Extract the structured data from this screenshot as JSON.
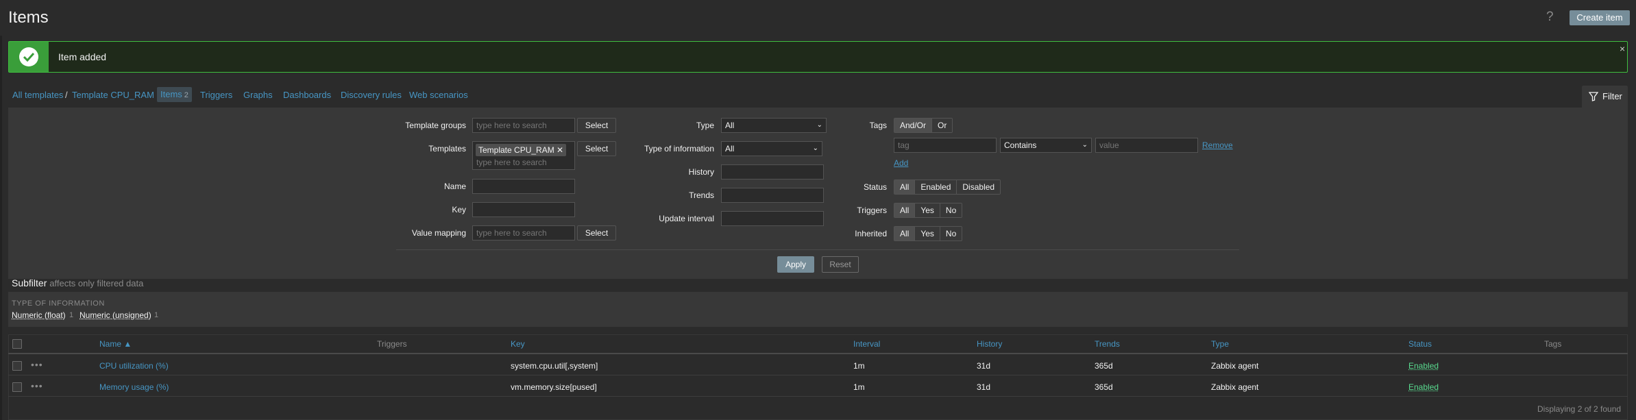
{
  "header": {
    "title": "Items",
    "help_icon": "?",
    "create_button": "Create item"
  },
  "message": {
    "text": "Item added",
    "close": "×",
    "color": "#3fbf3f"
  },
  "nav": {
    "all_templates": "All templates",
    "separator": "/",
    "template": "Template CPU_RAM",
    "items_label": "Items",
    "items_count": "2",
    "triggers": "Triggers",
    "graphs": "Graphs",
    "dashboards": "Dashboards",
    "discovery": "Discovery rules",
    "web": "Web scenarios",
    "filter": "Filter"
  },
  "filter": {
    "template_groups_label": "Template groups",
    "template_groups_placeholder": "type here to search",
    "select": "Select",
    "templates_label": "Templates",
    "templates_chip": "Template CPU_RAM",
    "templates_placeholder": "type here to search",
    "name_label": "Name",
    "key_label": "Key",
    "value_mapping_label": "Value mapping",
    "value_mapping_placeholder": "type here to search",
    "type_label": "Type",
    "type_value": "All",
    "type_info_label": "Type of information",
    "type_info_value": "All",
    "history_label": "History",
    "trends_label": "Trends",
    "update_interval_label": "Update interval",
    "tags_label": "Tags",
    "tags_andor": "And/Or",
    "tags_or": "Or",
    "tag_placeholder": "tag",
    "tag_operator": "Contains",
    "value_placeholder": "value",
    "remove": "Remove",
    "add": "Add",
    "status_label": "Status",
    "status_options": [
      "All",
      "Enabled",
      "Disabled"
    ],
    "triggers_label": "Triggers",
    "triggers_options": [
      "All",
      "Yes",
      "No"
    ],
    "inherited_label": "Inherited",
    "inherited_options": [
      "All",
      "Yes",
      "No"
    ],
    "apply": "Apply",
    "reset": "Reset"
  },
  "subfilter": {
    "title": "Subfilter",
    "hint": "affects only filtered data",
    "category": "TYPE OF INFORMATION",
    "items": [
      {
        "label": "Numeric (float)",
        "count": "1"
      },
      {
        "label": "Numeric (unsigned)",
        "count": "1"
      }
    ]
  },
  "table": {
    "columns": {
      "name": "Name ▲",
      "triggers": "Triggers",
      "key": "Key",
      "interval": "Interval",
      "history": "History",
      "trends": "Trends",
      "type": "Type",
      "status": "Status",
      "tags": "Tags"
    },
    "rows": [
      {
        "name": "CPU utilization (%)",
        "key": "system.cpu.util[,system]",
        "interval": "1m",
        "history": "31d",
        "trends": "365d",
        "type": "Zabbix agent",
        "status": "Enabled"
      },
      {
        "name": "Memory usage (%)",
        "key": "vm.memory.size[pused]",
        "interval": "1m",
        "history": "31d",
        "trends": "365d",
        "type": "Zabbix agent",
        "status": "Enabled"
      }
    ],
    "footer": "Displaying 2 of 2 found"
  }
}
